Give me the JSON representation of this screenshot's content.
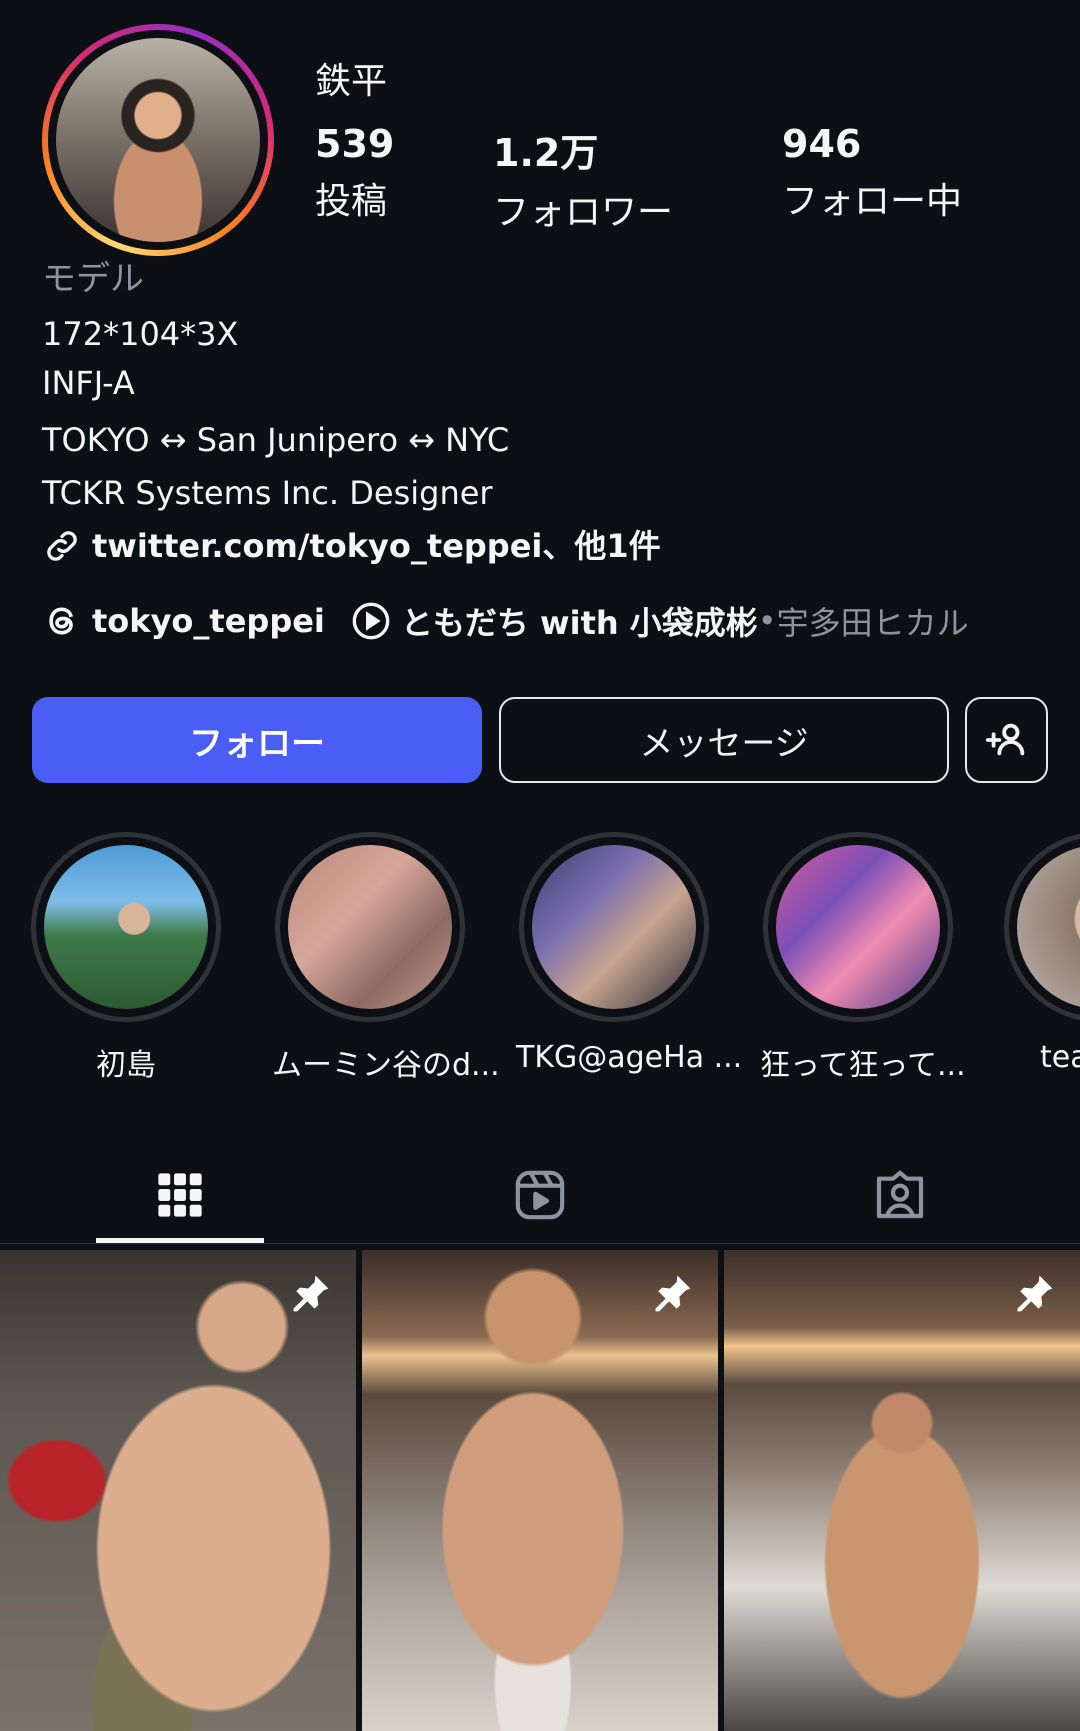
{
  "profile": {
    "name": "鉄平",
    "stats": [
      {
        "value": "539",
        "label": "投稿"
      },
      {
        "value": "1.2万",
        "label": "フォロワー"
      },
      {
        "value": "946",
        "label": "フォロー中"
      }
    ],
    "category": "モデル",
    "bio_lines": [
      "172*104*3X",
      "INFJ-A",
      "TOKYO ↔ San Junipero ↔ NYC",
      "TCKR Systems Inc. Designer"
    ],
    "link_text": "twitter.com/tokyo_teppei、他1件",
    "threads_handle": "tokyo_teppei",
    "music_title": "ともだち with 小袋成彬",
    "music_separator": " • ",
    "music_artist": "宇多田ヒカル"
  },
  "actions": {
    "follow": "フォロー",
    "message": "メッセージ"
  },
  "highlights": [
    {
      "label": "初島"
    },
    {
      "label": "ムーミン谷のd..."
    },
    {
      "label": "TKG@ageHa ..."
    },
    {
      "label": "狂って狂って..."
    },
    {
      "label": "tea"
    }
  ],
  "tabs": [
    {
      "icon": "grid-icon",
      "active": true
    },
    {
      "icon": "reels-icon",
      "active": false
    },
    {
      "icon": "tagged-icon",
      "active": false
    }
  ],
  "posts": [
    {
      "pinned": true
    },
    {
      "pinned": true
    },
    {
      "pinned": true
    }
  ],
  "colors": {
    "background": "#0c0f14",
    "follow_button": "#4a5ef5",
    "secondary_text": "#8e949c"
  }
}
